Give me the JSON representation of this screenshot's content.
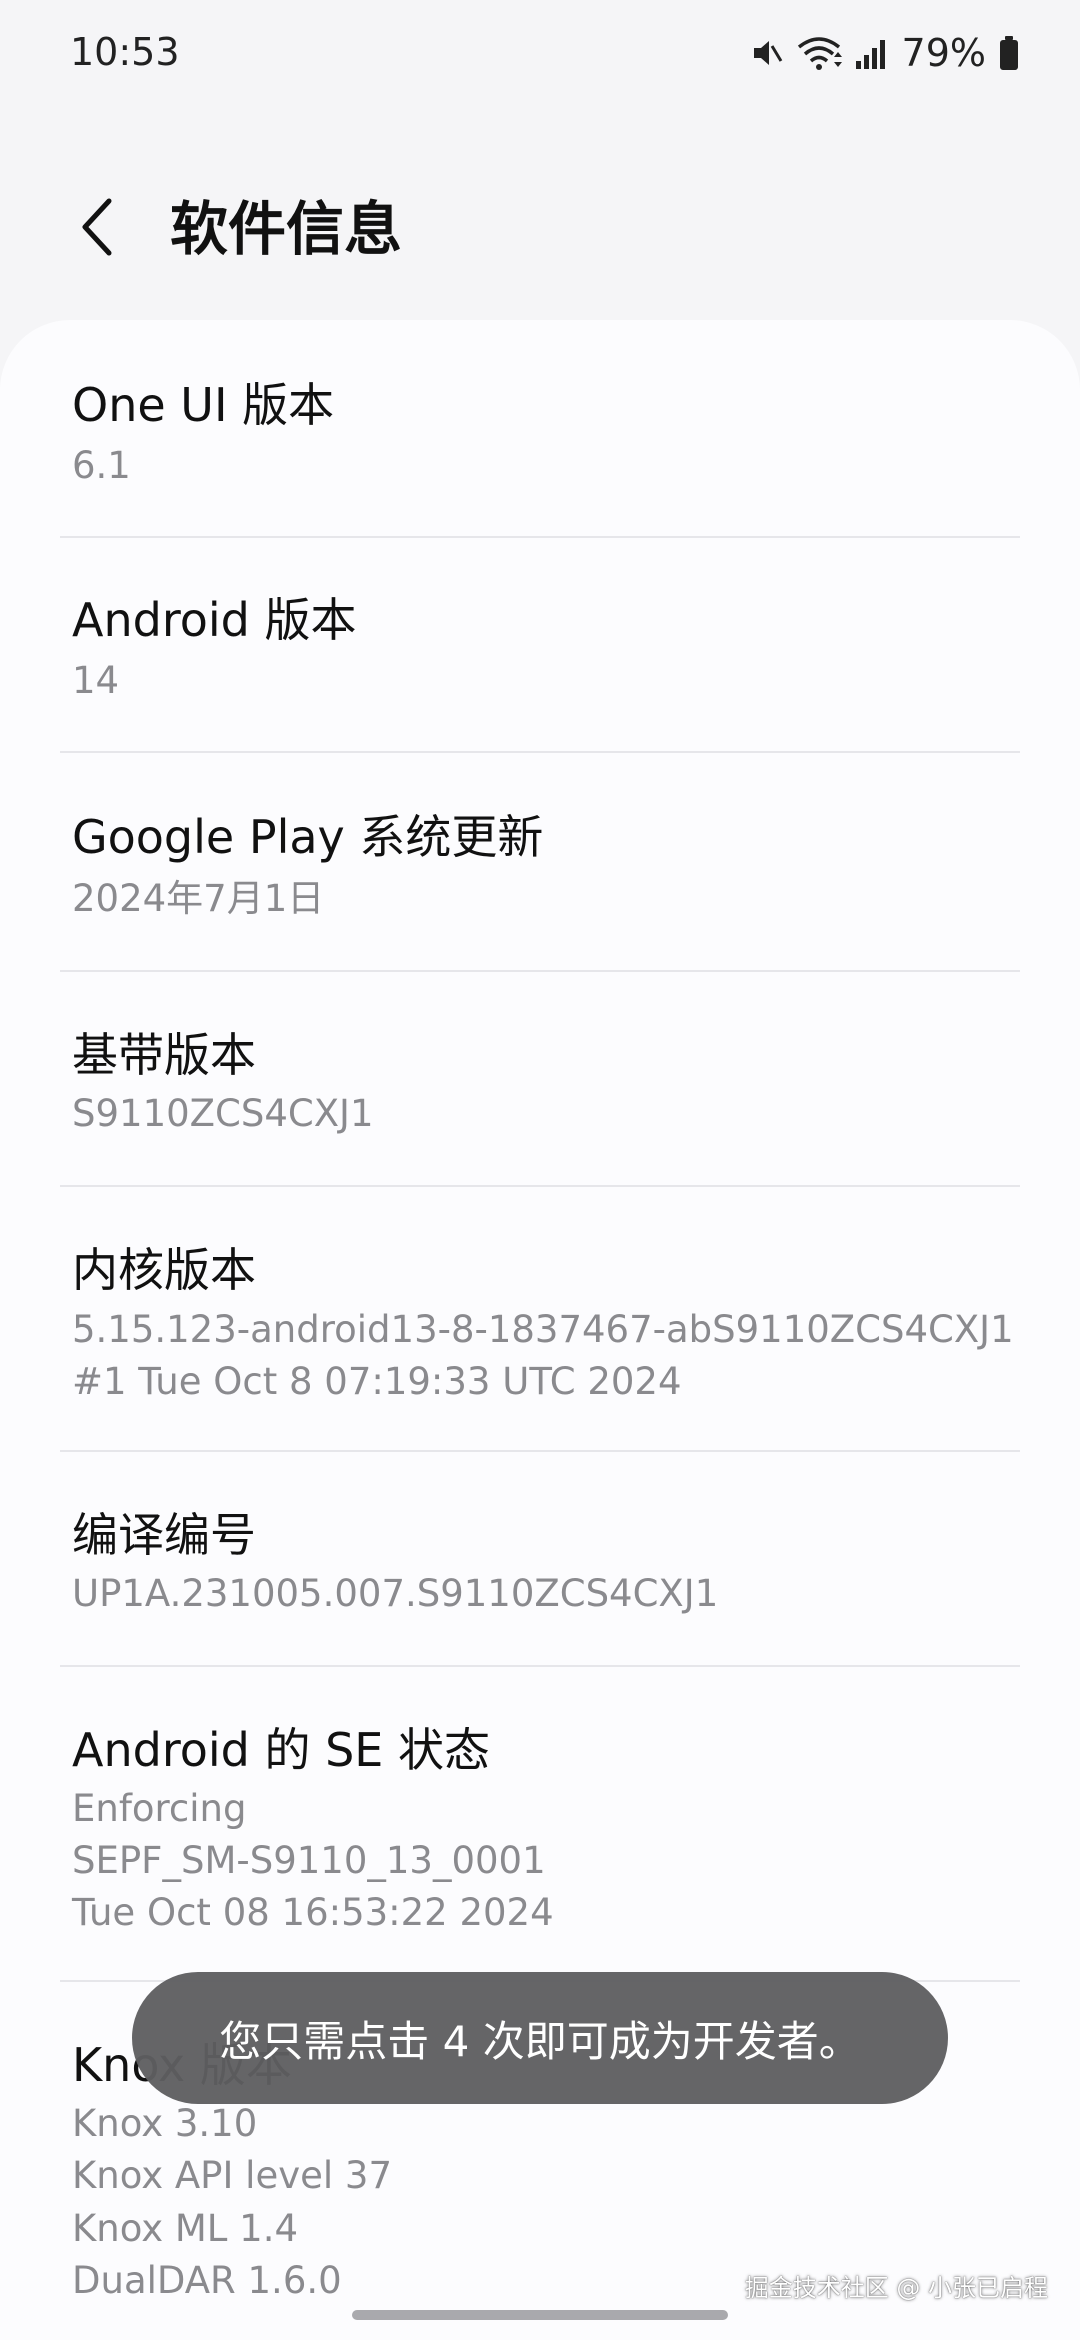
{
  "status_bar": {
    "time": "10:53",
    "battery": "79%",
    "icons": [
      "mute-icon",
      "wifi-icon",
      "signal-icon",
      "battery-icon"
    ]
  },
  "header": {
    "back_icon": "chevron-left-icon",
    "title": "软件信息"
  },
  "rows": [
    {
      "title": "One UI 版本",
      "lines": [
        "6.1"
      ]
    },
    {
      "title": "Android 版本",
      "lines": [
        "14"
      ]
    },
    {
      "title": "Google Play 系统更新",
      "lines": [
        "2024年7月1日"
      ]
    },
    {
      "title": "基带版本",
      "lines": [
        "S9110ZCS4CXJ1"
      ]
    },
    {
      "title": "内核版本",
      "lines": [
        "5.15.123-android13-8-1837467-abS9110ZCS4CXJ1",
        "#1 Tue Oct 8 07:19:33 UTC 2024"
      ]
    },
    {
      "title": "编译编号",
      "lines": [
        "UP1A.231005.007.S9110ZCS4CXJ1"
      ]
    },
    {
      "title": "Android 的 SE 状态",
      "lines": [
        "Enforcing",
        "SEPF_SM-S9110_13_0001",
        "Tue Oct 08 16:53:22 2024"
      ]
    },
    {
      "title": "Knox 版本",
      "lines": [
        "Knox 3.10",
        "Knox API level 37",
        "Knox ML 1.4",
        "DualDAR 1.6.0"
      ]
    }
  ],
  "toast": "您只需点击 4 次即可成为开发者。",
  "watermark": "掘金技术社区 @ 小张已启程",
  "colors": {
    "background": "#f5f5f7",
    "card": "#fcfcfe",
    "secondary_text": "#8a8a8e",
    "toast_bg": "#5f5f61"
  }
}
